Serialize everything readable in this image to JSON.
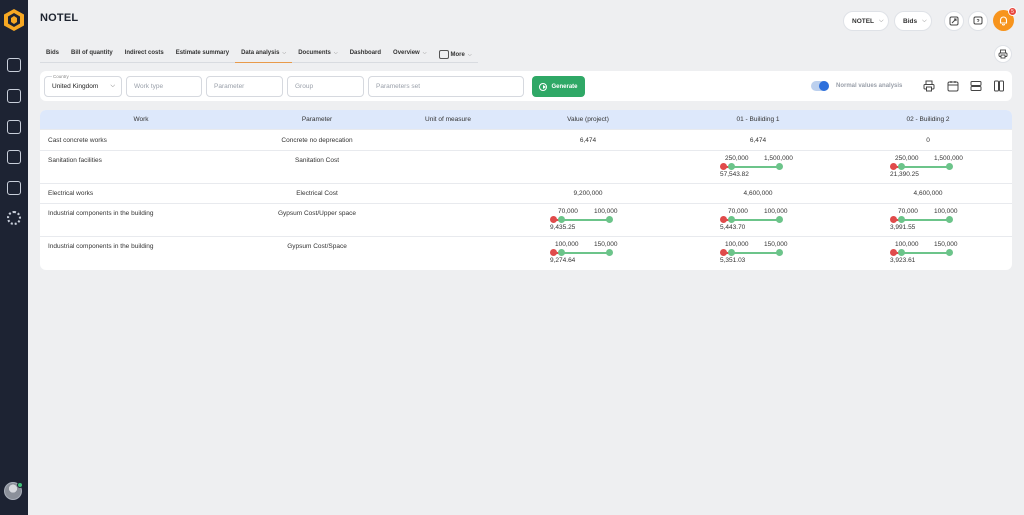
{
  "app": {
    "title": "NOTEL"
  },
  "header": {
    "project_pill": "NOTEL",
    "section_pill": "Bids",
    "notification_count": "5"
  },
  "tabs": [
    {
      "label": "Bids",
      "dropdown": false
    },
    {
      "label": "Bill of quantity",
      "dropdown": false
    },
    {
      "label": "Indirect costs",
      "dropdown": false
    },
    {
      "label": "Estimate summary",
      "dropdown": false
    },
    {
      "label": "Data analysis",
      "dropdown": true,
      "active": true
    },
    {
      "label": "Documents",
      "dropdown": true
    },
    {
      "label": "Dashboard",
      "dropdown": false
    },
    {
      "label": "Overview",
      "dropdown": true
    },
    {
      "label": "More",
      "dropdown": true
    }
  ],
  "filters": {
    "country_label": "Country",
    "country_value": "United Kingdom",
    "work_type_placeholder": "Work type",
    "parameter_placeholder": "Parameter",
    "group_placeholder": "Group",
    "parameters_set_placeholder": "Parameters set",
    "generate_label": "Generate",
    "toggle_label": "Normal values analysis",
    "toggle_on": true
  },
  "table": {
    "columns": [
      "Work",
      "Parameter",
      "Unit of measure",
      "Value (project)",
      "01 - Builiding 1",
      "02 - Builiding 2"
    ],
    "rows": [
      {
        "work": "Cast concrete works",
        "parameter": "Concrete no deprecation",
        "unit": "",
        "value": "6,474",
        "b1": "6,474",
        "b2": "0"
      },
      {
        "work": "Sanitation facilities",
        "parameter": "Sanitation Cost",
        "unit": "",
        "value": "",
        "b1_range": {
          "lo": "250,000",
          "hi": "1,500,000",
          "current": "57,543.82"
        },
        "b2_range": {
          "lo": "250,000",
          "hi": "1,500,000",
          "current": "21,390.25"
        }
      },
      {
        "work": "Electrical works",
        "parameter": "Electrical Cost",
        "unit": "",
        "value": "9,200,000",
        "b1": "4,600,000",
        "b2": "4,600,000"
      },
      {
        "work": "Industrial components in the building",
        "parameter": "Gypsum Cost/Upper space",
        "unit": "",
        "value_range": {
          "lo": "70,000",
          "hi": "100,000",
          "current": "9,435.25"
        },
        "b1_range": {
          "lo": "70,000",
          "hi": "100,000",
          "current": "5,443.70"
        },
        "b2_range": {
          "lo": "70,000",
          "hi": "100,000",
          "current": "3,991.55"
        }
      },
      {
        "work": "Industrial components in the building",
        "parameter": "Gypsum Cost/Space",
        "unit": "",
        "value_range": {
          "lo": "100,000",
          "hi": "150,000",
          "current": "9,274.64"
        },
        "b1_range": {
          "lo": "100,000",
          "hi": "150,000",
          "current": "5,351.03"
        },
        "b2_range": {
          "lo": "100,000",
          "hi": "150,000",
          "current": "3,923.61"
        }
      }
    ]
  },
  "colors": {
    "sidebar": "#1d2333",
    "accent_orange": "#f7941d",
    "generate_green": "#2fa866",
    "header_row": "#dde8fb",
    "below_range": "#e04b4b",
    "in_range": "#6cc48a"
  }
}
